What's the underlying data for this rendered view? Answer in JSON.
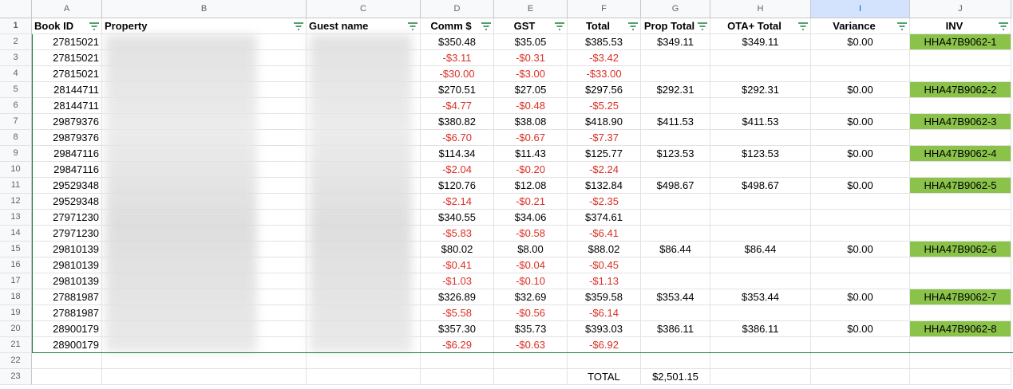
{
  "column_letters": [
    "A",
    "B",
    "C",
    "D",
    "E",
    "F",
    "G",
    "H",
    "I",
    "J"
  ],
  "headers": {
    "book_id": "Book ID",
    "property": "Property",
    "guest_name": "Guest name",
    "comm": "Comm $",
    "gst": "GST",
    "total": "Total",
    "prop_total": "Prop Total",
    "ota_total": "OTA+ Total",
    "variance": "Variance",
    "inv": "INV"
  },
  "row_numbers": [
    "1",
    "2",
    "3",
    "4",
    "5",
    "6",
    "7",
    "8",
    "9",
    "10",
    "11",
    "12",
    "13",
    "14",
    "15",
    "16",
    "17",
    "18",
    "19",
    "20",
    "21",
    "22",
    "23"
  ],
  "rows": [
    {
      "book_id": "27815021",
      "comm": "$350.48",
      "gst": "$35.05",
      "total": "$385.53",
      "prop_total": "$349.11",
      "ota_total": "$349.11",
      "variance": "$0.00",
      "inv": "HHA47B9062-1"
    },
    {
      "book_id": "27815021",
      "comm": "-$3.11",
      "gst": "-$0.31",
      "total": "-$3.42",
      "prop_total": "",
      "ota_total": "",
      "variance": "",
      "inv": ""
    },
    {
      "book_id": "27815021",
      "comm": "-$30.00",
      "gst": "-$3.00",
      "total": "-$33.00",
      "prop_total": "",
      "ota_total": "",
      "variance": "",
      "inv": ""
    },
    {
      "book_id": "28144711",
      "comm": "$270.51",
      "gst": "$27.05",
      "total": "$297.56",
      "prop_total": "$292.31",
      "ota_total": "$292.31",
      "variance": "$0.00",
      "inv": "HHA47B9062-2"
    },
    {
      "book_id": "28144711",
      "comm": "-$4.77",
      "gst": "-$0.48",
      "total": "-$5.25",
      "prop_total": "",
      "ota_total": "",
      "variance": "",
      "inv": ""
    },
    {
      "book_id": "29879376",
      "comm": "$380.82",
      "gst": "$38.08",
      "total": "$418.90",
      "prop_total": "$411.53",
      "ota_total": "$411.53",
      "variance": "$0.00",
      "inv": "HHA47B9062-3"
    },
    {
      "book_id": "29879376",
      "comm": "-$6.70",
      "gst": "-$0.67",
      "total": "-$7.37",
      "prop_total": "",
      "ota_total": "",
      "variance": "",
      "inv": ""
    },
    {
      "book_id": "29847116",
      "comm": "$114.34",
      "gst": "$11.43",
      "total": "$125.77",
      "prop_total": "$123.53",
      "ota_total": "$123.53",
      "variance": "$0.00",
      "inv": "HHA47B9062-4"
    },
    {
      "book_id": "29847116",
      "comm": "-$2.04",
      "gst": "-$0.20",
      "total": "-$2.24",
      "prop_total": "",
      "ota_total": "",
      "variance": "",
      "inv": ""
    },
    {
      "book_id": "29529348",
      "comm": "$120.76",
      "gst": "$12.08",
      "total": "$132.84",
      "prop_total": "$498.67",
      "ota_total": "$498.67",
      "variance": "$0.00",
      "inv": "HHA47B9062-5"
    },
    {
      "book_id": "29529348",
      "comm": "-$2.14",
      "gst": "-$0.21",
      "total": "-$2.35",
      "prop_total": "",
      "ota_total": "",
      "variance": "",
      "inv": ""
    },
    {
      "book_id": "27971230",
      "comm": "$340.55",
      "gst": "$34.06",
      "total": "$374.61",
      "prop_total": "",
      "ota_total": "",
      "variance": "",
      "inv": ""
    },
    {
      "book_id": "27971230",
      "comm": "-$5.83",
      "gst": "-$0.58",
      "total": "-$6.41",
      "prop_total": "",
      "ota_total": "",
      "variance": "",
      "inv": ""
    },
    {
      "book_id": "29810139",
      "comm": "$80.02",
      "gst": "$8.00",
      "total": "$88.02",
      "prop_total": "$86.44",
      "ota_total": "$86.44",
      "variance": "$0.00",
      "inv": "HHA47B9062-6"
    },
    {
      "book_id": "29810139",
      "comm": "-$0.41",
      "gst": "-$0.04",
      "total": "-$0.45",
      "prop_total": "",
      "ota_total": "",
      "variance": "",
      "inv": ""
    },
    {
      "book_id": "29810139",
      "comm": "-$1.03",
      "gst": "-$0.10",
      "total": "-$1.13",
      "prop_total": "",
      "ota_total": "",
      "variance": "",
      "inv": ""
    },
    {
      "book_id": "27881987",
      "comm": "$326.89",
      "gst": "$32.69",
      "total": "$359.58",
      "prop_total": "$353.44",
      "ota_total": "$353.44",
      "variance": "$0.00",
      "inv": "HHA47B9062-7"
    },
    {
      "book_id": "27881987",
      "comm": "-$5.58",
      "gst": "-$0.56",
      "total": "-$6.14",
      "prop_total": "",
      "ota_total": "",
      "variance": "",
      "inv": ""
    },
    {
      "book_id": "28900179",
      "comm": "$357.30",
      "gst": "$35.73",
      "total": "$393.03",
      "prop_total": "$386.11",
      "ota_total": "$386.11",
      "variance": "$0.00",
      "inv": "HHA47B9062-8"
    },
    {
      "book_id": "28900179",
      "comm": "-$6.29",
      "gst": "-$0.63",
      "total": "-$6.92",
      "prop_total": "",
      "ota_total": "",
      "variance": "",
      "inv": ""
    }
  ],
  "footer": {
    "total_label": "TOTAL",
    "total_value": "$2,501.15"
  },
  "colors": {
    "negative": "#d93025",
    "inv_fill": "#8bc34a",
    "filter_border": "#188038",
    "selected_col": "#d3e3fd"
  }
}
